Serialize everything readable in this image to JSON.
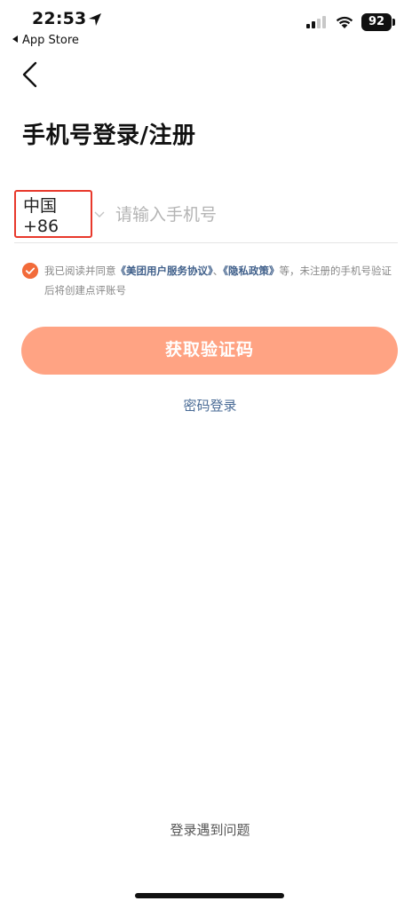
{
  "status_bar": {
    "time": "22:53",
    "back_app": "App Store",
    "battery": "92"
  },
  "header": {
    "title": "手机号登录/注册"
  },
  "phone": {
    "country_code": "中国 +86",
    "placeholder": "请输入手机号",
    "value": ""
  },
  "agreement": {
    "checked": true,
    "prefix": "我已阅读并同意",
    "user_agreement": "《美团用户服务协议》",
    "separator": "、",
    "privacy_policy": "《隐私政策》",
    "suffix": "等，未注册的手机号验证后将创建点评账号"
  },
  "actions": {
    "get_code": "获取验证码",
    "password_login": "密码登录",
    "login_help": "登录遇到问题"
  },
  "colors": {
    "accent": "#f26b3a",
    "button": "#ffa383",
    "link": "#3f5f8a",
    "highlight_box": "#e8382b"
  }
}
